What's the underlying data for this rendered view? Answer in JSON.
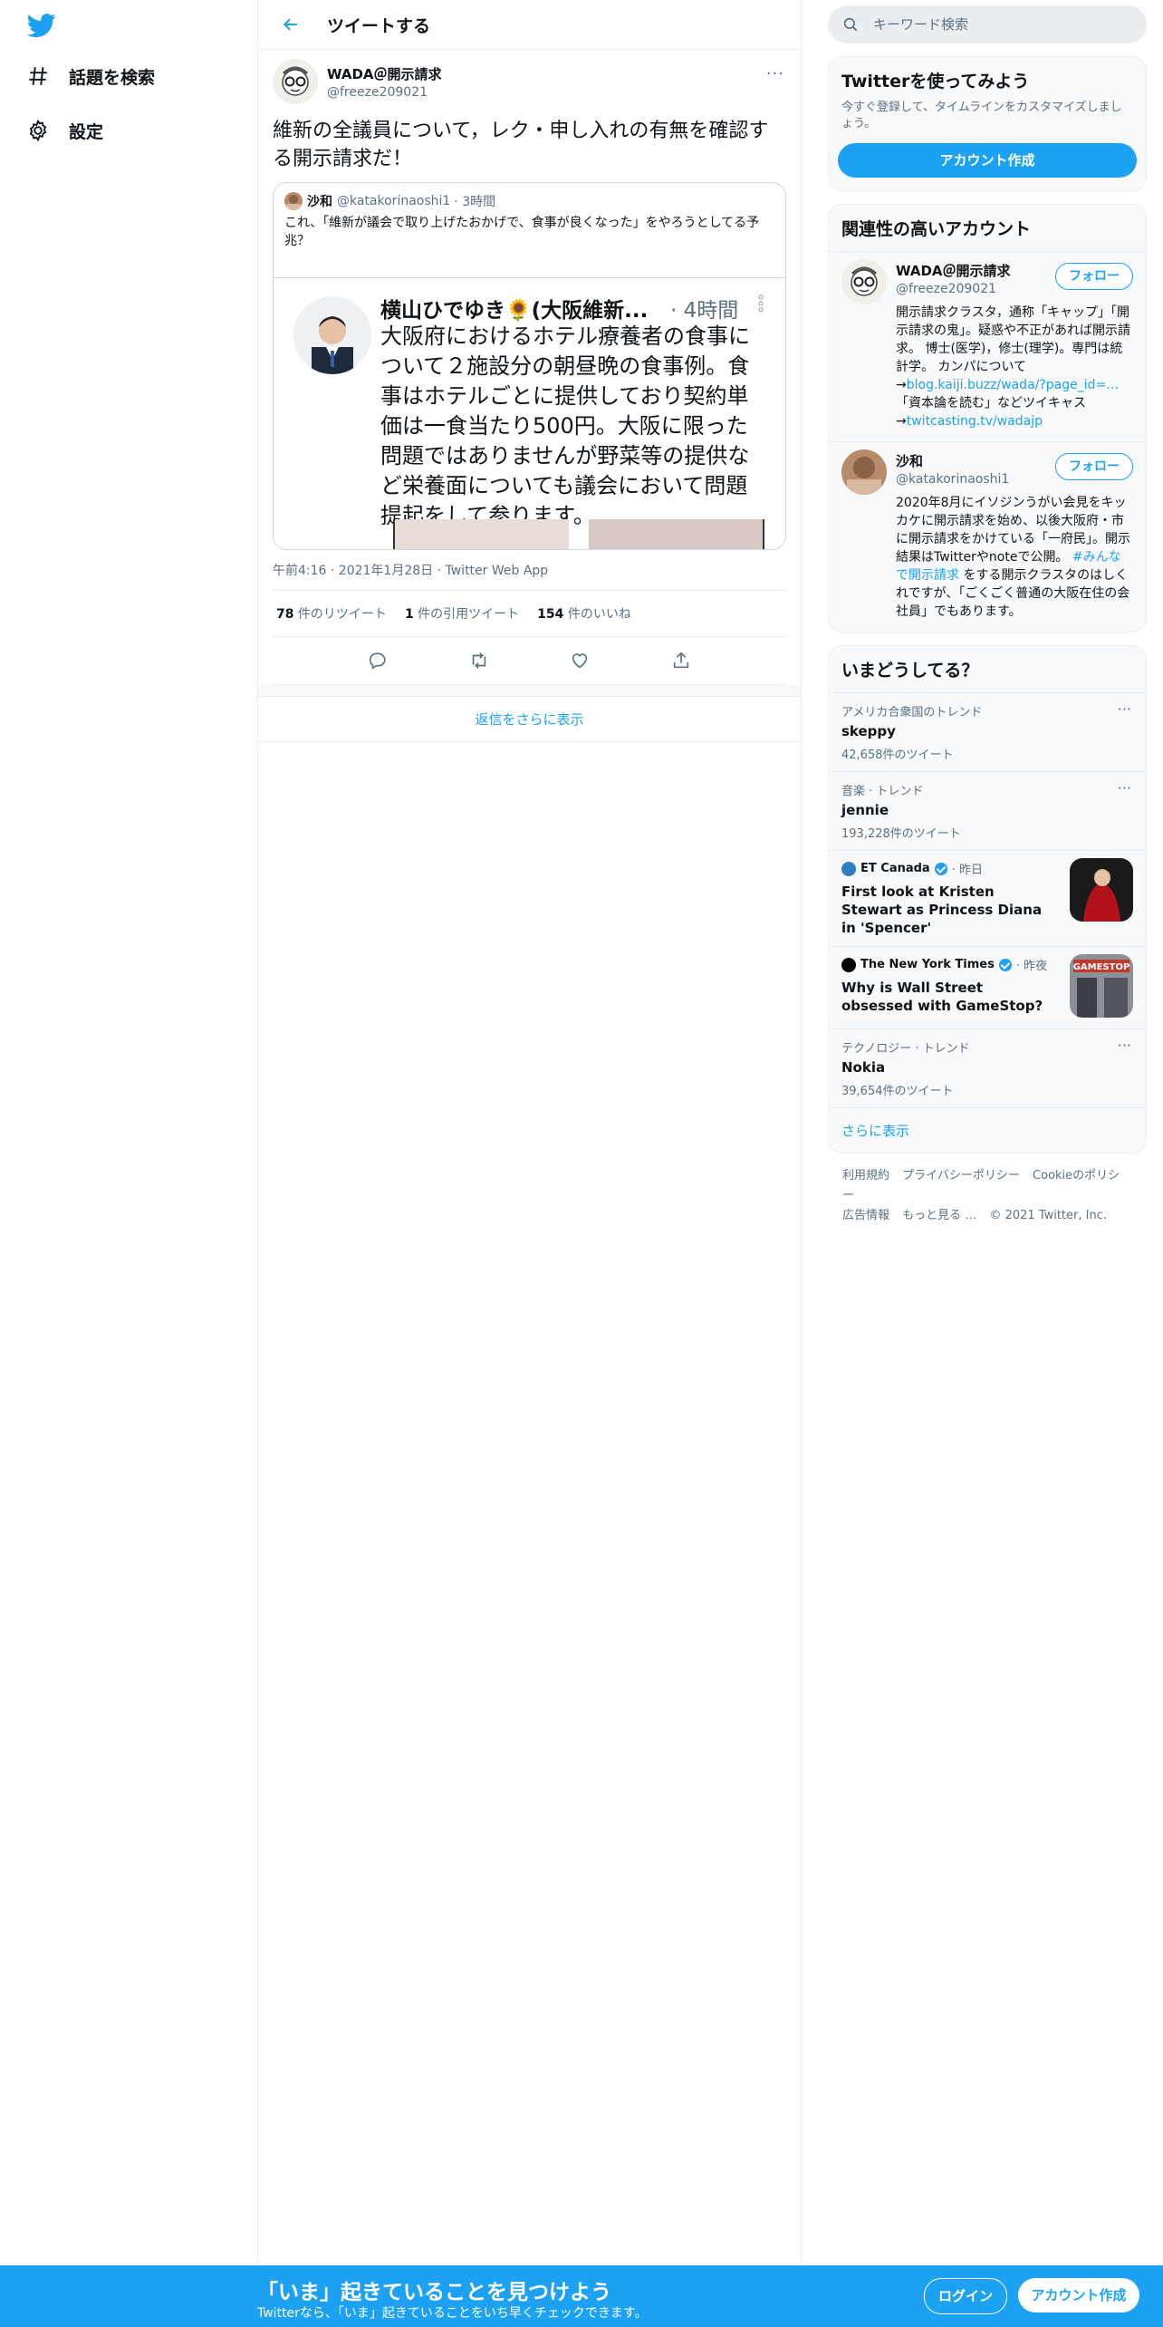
{
  "nav": {
    "items": [
      {
        "label": "話題を検索",
        "icon": "hashtag-icon"
      },
      {
        "label": "設定",
        "icon": "gear-icon"
      }
    ]
  },
  "header": {
    "title": "ツイートする"
  },
  "tweet": {
    "author_name": "WADA＠開示請求",
    "author_handle": "@freeze209021",
    "text": "維新の全議員について，レク・申し入れの有無を確認する開示請求だ！",
    "quote": {
      "author_name": "沙和",
      "author_handle": "@katakorinaoshi1",
      "time": "· 3時間",
      "text": "これ、「維新が議会で取り上げたおかげで、食事が良くなった」をやろうとしてる予兆？",
      "embed": {
        "name": "横山ひでゆき🌻(大阪維新...",
        "time": "· 4時間",
        "text": "大阪府におけるホテル療養者の食事について２施設分の朝昼晩の食事例。食事はホテルごとに提供しており契約単価は一食当たり500円。大阪に限った問題ではありませんが野菜等の提供など栄養面についても議会において問題提起をして参ります。"
      }
    },
    "meta": "午前4:16 · 2021年1月28日 · Twitter Web App",
    "stats": {
      "retweets_count": "78",
      "retweets_label": " 件のリツイート",
      "quotes_count": "1",
      "quotes_label": " 件の引用ツイート",
      "likes_count": "154",
      "likes_label": " 件のいいね"
    },
    "show_more_replies": "返信をさらに表示"
  },
  "search": {
    "placeholder": "キーワード検索"
  },
  "signup_card": {
    "title": "Twitterを使ってみよう",
    "subtitle": "今すぐ登録して、タイムラインをカスタマイズしましょう。",
    "button": "アカウント作成"
  },
  "related": {
    "title": "関連性の高いアカウント",
    "follow_label": "フォロー",
    "accounts": [
      {
        "name": "WADA＠開示請求",
        "handle": "@freeze209021",
        "bio_1": "開示請求クラスタ，通称「キャップ」「開示請求の鬼」。疑惑や不正があれば開示請求。 博士(医学)，修士(理学)。専門は統計学。 カンパについて→",
        "bio_link_1": "blog.kaiji.buzz/wada/?page_id=…",
        "bio_2": "「資本論を読む」などツイキャス→",
        "bio_link_2": "twitcasting.tv/wadajp"
      },
      {
        "name": "沙和",
        "handle": "@katakorinaoshi1",
        "bio_1": "2020年8月にイソジンうがい会見をキッカケに開示請求を始め、以後大阪府・市に開示請求をかけている「一府民」。開示結果はTwitterやnoteで公開。 ",
        "bio_link_1": "#みんなで開示請求",
        "bio_2": " をする開示クラスタのはしくれですが、「ごくごく普通の大阪在住の会社員」でもあります。"
      }
    ]
  },
  "trends": {
    "title": "いまどうしてる？",
    "items": [
      {
        "context": "アメリカ合衆国のトレンド",
        "name": "skeppy",
        "count": "42,658件のツイート"
      },
      {
        "context": "音楽 · トレンド",
        "name": "jennie",
        "count": "193,228件のツイート"
      },
      {
        "source": "ET Canada",
        "time": "· 昨日",
        "headline": "First look at Kristen Stewart as Princess Diana in 'Spencer'"
      },
      {
        "source": "The New York Times",
        "time": "· 昨夜",
        "headline": "Why is Wall Street obsessed with GameStop?",
        "thumb_text": "GAMESTOP"
      },
      {
        "context": "テクノロジー · トレンド",
        "name": "Nokia",
        "count": "39,654件のツイート"
      }
    ],
    "show_more": "さらに表示"
  },
  "footer": {
    "links": [
      "利用規約",
      "プライバシーポリシー",
      "Cookieのポリシー",
      "広告情報",
      "もっと見る …"
    ],
    "copyright": "© 2021 Twitter, Inc."
  },
  "bottom_bar": {
    "title": "「いま」起きていることを見つけよう",
    "subtitle": "Twitterなら、「いま」起きていることをいち早くチェックできます。",
    "login": "ログイン",
    "signup": "アカウント作成"
  },
  "colors": {
    "accent": "#1da1f2",
    "text": "#0f1419",
    "muted": "#5b7083",
    "border": "#ebeef0"
  }
}
